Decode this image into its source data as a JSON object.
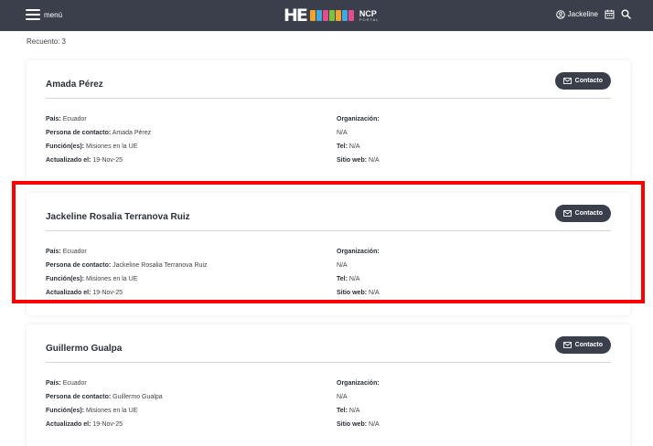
{
  "header": {
    "menu_label": "menú",
    "logo_he": "HE",
    "logo_ncp": "NCP",
    "logo_portal": "PORTAL",
    "user_name": "Jackeline",
    "book_colors": [
      "#f2a32a",
      "#3fa9e0",
      "#e84b8a",
      "#7bc142",
      "#f2a32a",
      "#3fa9e0",
      "#e84b8a"
    ]
  },
  "results": {
    "count_label": "Recuento:",
    "count": "3"
  },
  "labels": {
    "pais": "País:",
    "persona": "Persona de contacto:",
    "funcion": "Función(es):",
    "actualizado": "Actualizado el:",
    "organizacion": "Organización:",
    "tel": "Tel:",
    "sitio": "Sitio web:",
    "contact_button": "Contacto"
  },
  "contacts": [
    {
      "name": "Amada Pérez",
      "pais": "Ecuador",
      "persona": "Amada Pérez",
      "funcion": "Misiones en la UE",
      "actualizado": "19-Nov-25",
      "organizacion": "",
      "org_value": "N/A",
      "tel": "N/A",
      "sitio": "N/A"
    },
    {
      "name": "Jackeline Rosalia Terranova Ruiz",
      "pais": "Ecuador",
      "persona": "Jackeline Rosalia Terranova Ruiz",
      "funcion": "Misiones en la UE",
      "actualizado": "19-Nov-25",
      "organizacion": "",
      "org_value": "N/A",
      "tel": "N/A",
      "sitio": "N/A"
    },
    {
      "name": "Guillermo Gualpa",
      "pais": "Ecuador",
      "persona": "Guillermo Gualpa",
      "funcion": "Misiones en la UE",
      "actualizado": "19-Nov-25",
      "organizacion": "",
      "org_value": "N/A",
      "tel": "N/A",
      "sitio": "N/A"
    }
  ],
  "colors": {
    "topbar": "#3a3f4b",
    "button": "#3a3f4b",
    "highlight": "#ff0000"
  }
}
